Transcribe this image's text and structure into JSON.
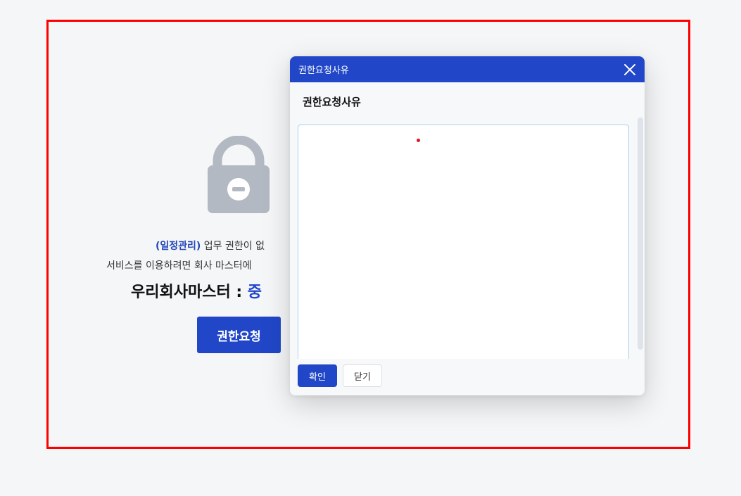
{
  "page": {
    "message": {
      "highlight": "(일정관리)",
      "line1_rest": " 업무 권한이 없",
      "line2": "서비스를 이용하려면 회사 마스터에",
      "master_label": "우리회사마스터 : ",
      "master_name": "중"
    },
    "request_button": "권한요청",
    "lock_icon": "lock-icon"
  },
  "dialog": {
    "title": "권한요청사유",
    "subtitle": "권한요청사유",
    "textarea_value": "",
    "confirm_label": "확인",
    "close_label": "닫기"
  },
  "colors": {
    "accent": "#2147c8",
    "frame_border": "#ff0000",
    "lock_gray": "#b3b9c2"
  }
}
